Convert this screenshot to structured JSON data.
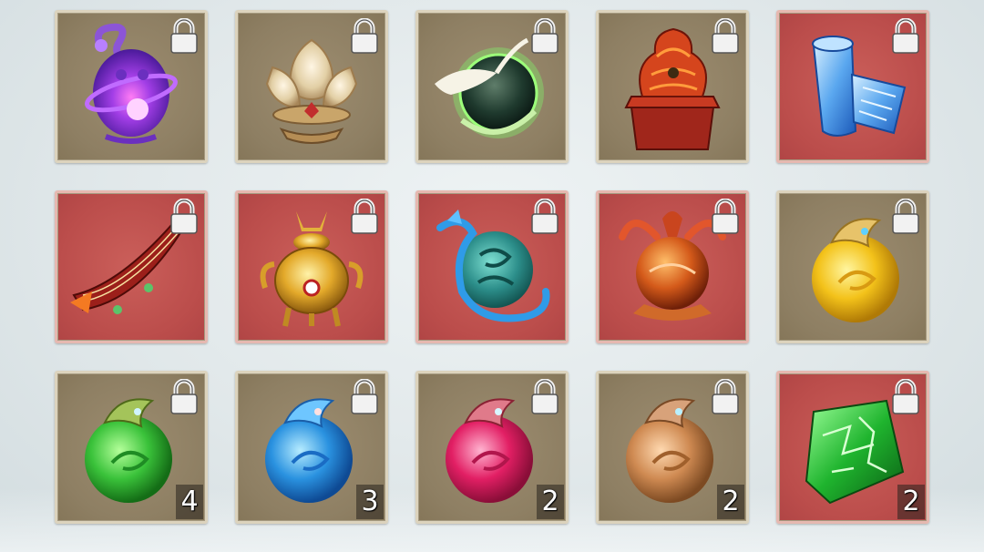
{
  "inventory": {
    "items": [
      {
        "icon": "purple-lantern-icon",
        "rarity": "normal",
        "locked": true,
        "count": ""
      },
      {
        "icon": "golden-lotus-icon",
        "rarity": "normal",
        "locked": true,
        "count": ""
      },
      {
        "icon": "jade-orb-crane-icon",
        "rarity": "normal",
        "locked": true,
        "count": ""
      },
      {
        "icon": "dragon-seal-icon",
        "rarity": "normal",
        "locked": true,
        "count": ""
      },
      {
        "icon": "ice-scroll-icon",
        "rarity": "rare",
        "locked": true,
        "count": ""
      },
      {
        "icon": "phoenix-guqin-icon",
        "rarity": "rare",
        "locked": true,
        "count": ""
      },
      {
        "icon": "golden-censer-icon",
        "rarity": "rare",
        "locked": true,
        "count": ""
      },
      {
        "icon": "azure-dragon-orb-icon",
        "rarity": "rare",
        "locked": true,
        "count": ""
      },
      {
        "icon": "phoenix-fire-orb-icon",
        "rarity": "rare",
        "locked": true,
        "count": ""
      },
      {
        "icon": "yellow-spirit-orb-icon",
        "rarity": "normal",
        "locked": true,
        "count": ""
      },
      {
        "icon": "green-spirit-orb-icon",
        "rarity": "normal",
        "locked": true,
        "count": "4"
      },
      {
        "icon": "blue-spirit-orb-icon",
        "rarity": "normal",
        "locked": true,
        "count": "3"
      },
      {
        "icon": "red-spirit-orb-icon",
        "rarity": "normal",
        "locked": true,
        "count": "2"
      },
      {
        "icon": "bronze-spirit-orb-icon",
        "rarity": "normal",
        "locked": true,
        "count": "2"
      },
      {
        "icon": "jade-gem-icon",
        "rarity": "rare",
        "locked": true,
        "count": "2"
      }
    ]
  },
  "colors": {
    "normal_slot": "#8e7f63",
    "rare_slot": "#bb4d4b",
    "lock_body": "#f2f2f2",
    "lock_outline": "#555555"
  }
}
